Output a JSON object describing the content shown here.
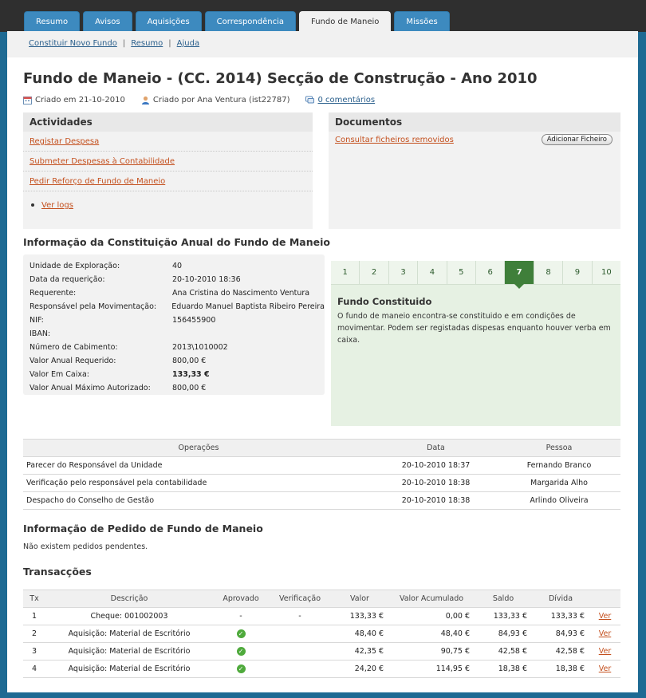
{
  "tabs": [
    "Resumo",
    "Avisos",
    "Aquisições",
    "Correspondência",
    "Fundo de Maneio",
    "Missões"
  ],
  "active_tab": 4,
  "subnav": [
    "Constituir Novo Fundo",
    "Resumo",
    "Ajuda"
  ],
  "subnav_sep": "|",
  "page_title": "Fundo de Maneio - (CC. 2014) Secção de Construção - Ano 2010",
  "meta": {
    "created_on": "Criado em 21-10-2010",
    "created_by": "Criado por Ana Ventura (ist22787)",
    "comments": "0 comentários"
  },
  "activities": {
    "title": "Actividades",
    "items": [
      "Registar Despesa",
      "Submeter Despesas à Contabilidade",
      "Pedir Reforço de Fundo de Maneio"
    ],
    "logs_link": "Ver logs"
  },
  "documents": {
    "title": "Documentos",
    "removed_link": "Consultar ficheiros removidos",
    "add_button": "Adicionar Ficheiro"
  },
  "constitution": {
    "title": "Informação da Constituição Anual do Fundo de Maneio",
    "rows": [
      {
        "k": "Unidade de Exploração:",
        "v": "40"
      },
      {
        "k": "Data da requerição:",
        "v": "20-10-2010 18:36"
      },
      {
        "k": "Requerente:",
        "v": "Ana Cristina do Nascimento Ventura"
      },
      {
        "k": "Responsável pela Movimentação:",
        "v": "Eduardo Manuel Baptista Ribeiro Pereira"
      },
      {
        "k": "NIF:",
        "v": "156455900"
      },
      {
        "k": "IBAN:",
        "v": ""
      },
      {
        "k": "Número de Cabimento:",
        "v": "2013\\1010002"
      },
      {
        "k": "Valor Anual Requerido:",
        "v": "800,00 €"
      },
      {
        "k": "Valor Em Caixa:",
        "v": "133,33 €",
        "bold": true
      },
      {
        "k": "Valor Anual Máximo Autorizado:",
        "v": "800,00 €"
      }
    ]
  },
  "progress": {
    "steps": [
      "1",
      "2",
      "3",
      "4",
      "5",
      "6",
      "7",
      "8",
      "9",
      "10"
    ],
    "current_step": 7,
    "state_title": "Fundo Constituido",
    "state_desc": "O fundo de maneio encontra-se constituido e em condições de movimentar. Podem ser registadas dispesas enquanto houver verba em caixa.",
    "accent": "#3f7f3a"
  },
  "operations": {
    "headers": [
      "Operações",
      "Data",
      "Pessoa"
    ],
    "rows": [
      [
        "Parecer do Responsável da Unidade",
        "20-10-2010 18:37",
        "Fernando Branco"
      ],
      [
        "Verificação pelo responsável pela contabilidade",
        "20-10-2010 18:38",
        "Margarida Alho"
      ],
      [
        "Despacho do Conselho de Gestão",
        "20-10-2010 18:38",
        "Arlindo Oliveira"
      ]
    ]
  },
  "requests": {
    "title": "Informação de Pedido de Fundo de Maneio",
    "empty": "Não existem pedidos pendentes."
  },
  "transactions": {
    "title": "Transacções",
    "headers": [
      "Tx",
      "Descrição",
      "Aprovado",
      "Verificação",
      "Valor",
      "Valor Acumulado",
      "Saldo",
      "Dívida",
      ""
    ],
    "rows": [
      {
        "tx": "1",
        "desc": "Cheque: 001002003",
        "approved": "-",
        "verified": "-",
        "value": "133,33 €",
        "acc": "0,00 €",
        "balance": "133,33 €",
        "debt": "133,33 €",
        "link": "Ver"
      },
      {
        "tx": "2",
        "desc": "Aquisição: Material de Escritório",
        "approved": "check",
        "verified": "",
        "value": "48,40 €",
        "acc": "48,40 €",
        "balance": "84,93 €",
        "debt": "84,93 €",
        "link": "Ver"
      },
      {
        "tx": "3",
        "desc": "Aquisição: Material de Escritório",
        "approved": "check",
        "verified": "",
        "value": "42,35 €",
        "acc": "90,75 €",
        "balance": "42,58 €",
        "debt": "42,58 €",
        "link": "Ver"
      },
      {
        "tx": "4",
        "desc": "Aquisição: Material de Escritório",
        "approved": "check",
        "verified": "",
        "value": "24,20 €",
        "acc": "114,95 €",
        "balance": "18,38 €",
        "debt": "18,38 €",
        "link": "Ver"
      }
    ]
  }
}
